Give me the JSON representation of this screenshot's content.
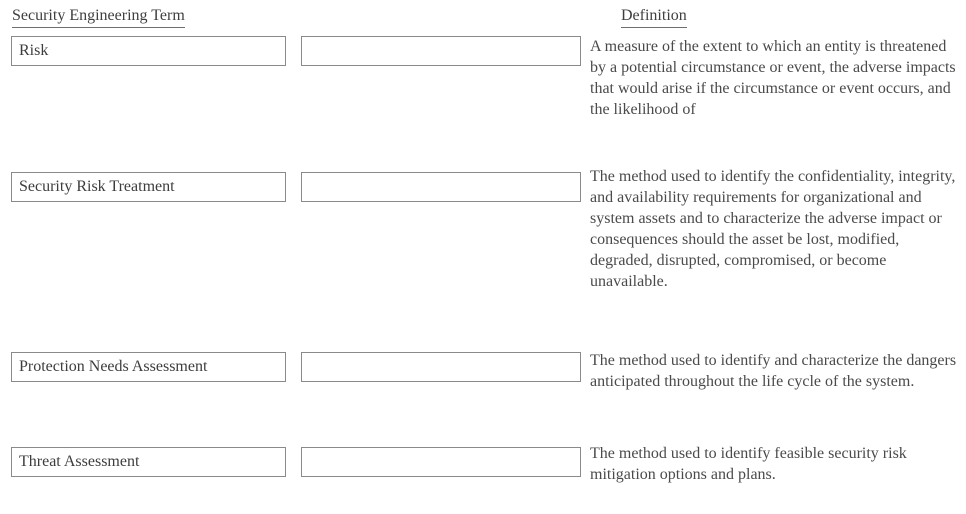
{
  "headers": {
    "term_column": "Security Engineering Term",
    "definition_column": "Definition"
  },
  "rows": [
    {
      "term": "Risk",
      "answer": "",
      "definition": "A measure of the extent to which an entity is threatened by a potential circumstance or event, the adverse impacts that would arise if the circumstance or event occurs, and the likelihood of"
    },
    {
      "term": "Security Risk Treatment",
      "answer": "",
      "definition": "The method used to identify the confidentiality, integrity, and availability requirements for organizational and system assets and to characterize the adverse impact or consequences should the asset be lost, modified, degraded, disrupted, compromised, or become unavailable."
    },
    {
      "term": "Protection Needs Assessment",
      "answer": "",
      "definition": "The method used to identify and characterize the dangers anticipated throughout the life cycle of the system."
    },
    {
      "term": "Threat Assessment",
      "answer": "",
      "definition": "The method used to identify feasible security risk mitigation options and plans."
    }
  ],
  "colors": {
    "text": "#4a4a4a",
    "border": "#8a8a8a",
    "background": "#ffffff"
  }
}
